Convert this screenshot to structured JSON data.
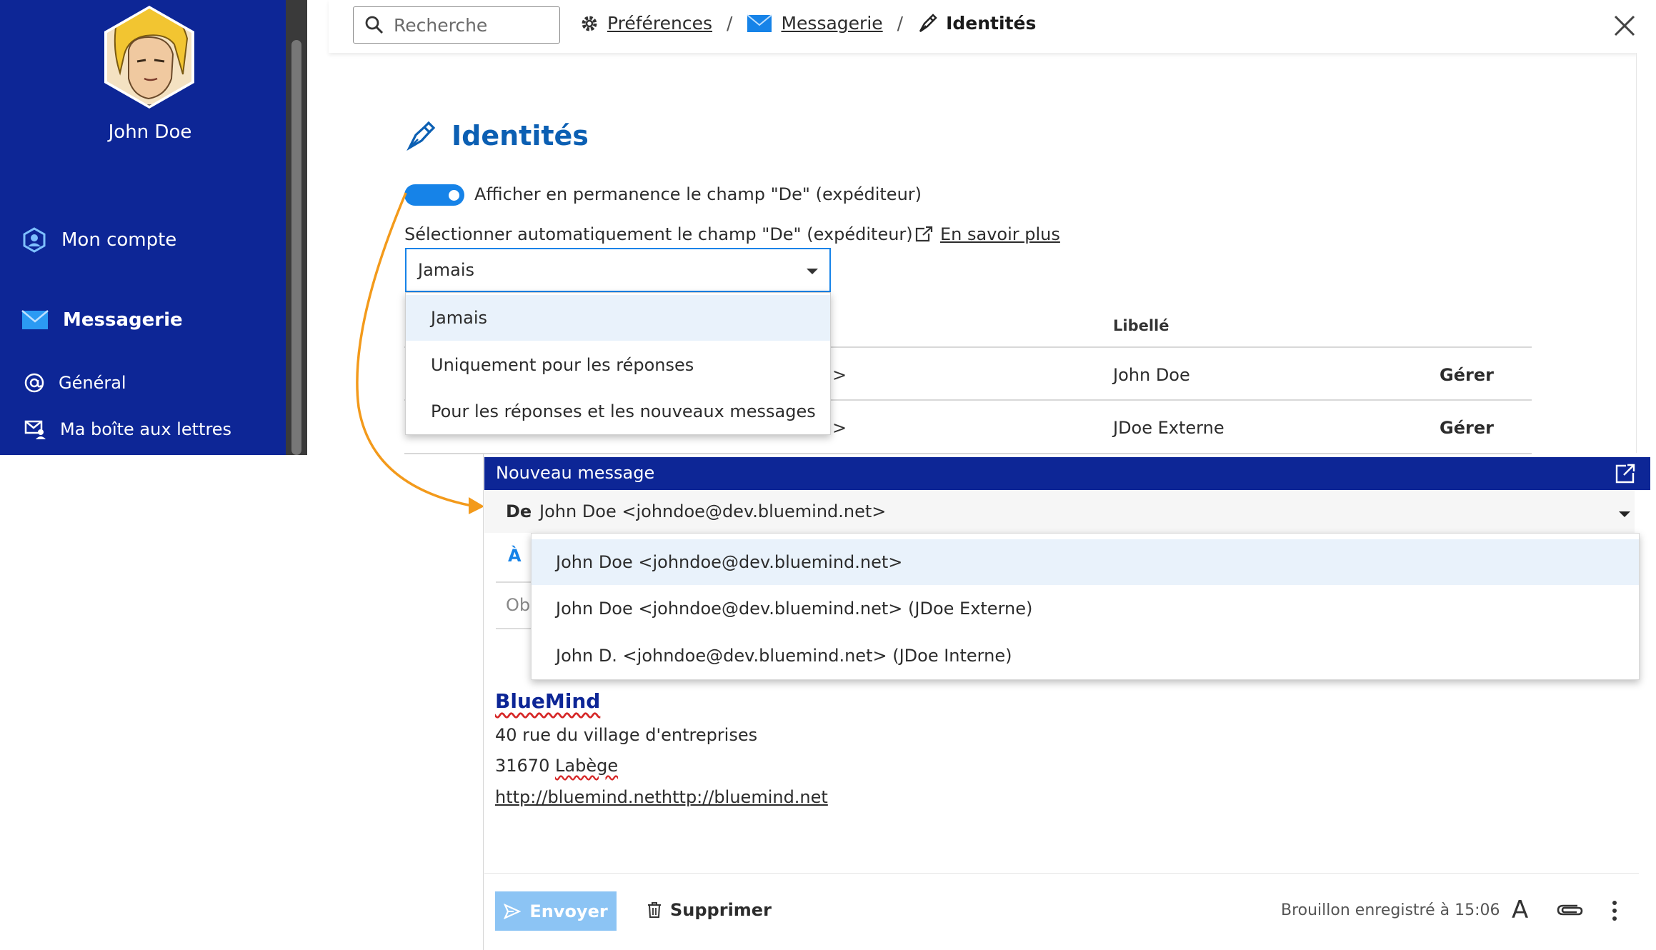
{
  "sidebar": {
    "user_name": "John Doe",
    "items": [
      {
        "label": "Mon compte"
      },
      {
        "label": "Messagerie"
      },
      {
        "label": "Général"
      },
      {
        "label": "Ma boîte aux lettres"
      }
    ]
  },
  "topbar": {
    "search_placeholder": "Recherche",
    "breadcrumb": [
      "Préférences",
      "Messagerie",
      "Identités"
    ],
    "separator": "/"
  },
  "preferences": {
    "title": "Identités",
    "toggle_label": "Afficher en permanence le champ \"De\" (expéditeur)",
    "toggle_on": true,
    "auto_select_label": "Sélectionner automatiquement le champ \"De\" (expéditeur)",
    "learn_more": "En savoir plus",
    "select_value": "Jamais",
    "select_options": [
      "Jamais",
      "Uniquement pour les réponses",
      "Pour les réponses et les nouveaux messages"
    ],
    "table": {
      "column_label": "Libellé",
      "rows": [
        {
          "label": "John Doe",
          "action": "Gérer",
          "tail": ">"
        },
        {
          "label": "JDoe Externe",
          "action": "Gérer",
          "tail": ">"
        }
      ]
    }
  },
  "composer": {
    "title": "Nouveau message",
    "from_label": "De",
    "from_value": "John Doe <johndoe@dev.bluemind.net>",
    "to_label": "À",
    "subject_label": "Ob",
    "from_options": [
      "John Doe <johndoe@dev.bluemind.net>",
      "John Doe <johndoe@dev.bluemind.net> (JDoe Externe)",
      "John D. <johndoe@dev.bluemind.net> (JDoe Interne)"
    ],
    "signature": {
      "company": "BlueMind",
      "address1": "40 rue du village d'entreprises",
      "address2_zip": "31670",
      "address2_city": "Labège",
      "url": "http://bluemind.nethttp://bluemind.net"
    },
    "send_label": "Envoyer",
    "delete_label": "Supprimer",
    "draft_status": "Brouillon enregistré à 15:06",
    "format_glyph": "A"
  },
  "colors": {
    "sidebar_bg": "#0d2696",
    "accent": "#1683e8",
    "title_blue": "#0b5fb3",
    "arrow": "#f39a1b",
    "send_disabled": "#8cc4f4"
  }
}
